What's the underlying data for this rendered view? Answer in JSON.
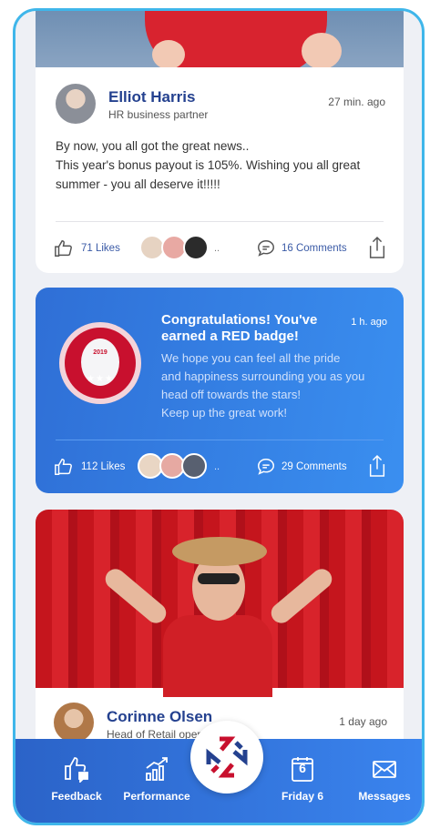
{
  "colors": {
    "accent": "#24418f",
    "frame": "#3fb6ea",
    "badge_red": "#c8102e",
    "nav_blue": "#2b63c8"
  },
  "post1": {
    "author": "Elliot Harris",
    "role": "HR business partner",
    "time": "27 min. ago",
    "lines": [
      "By now, you all got the great news..",
      "This year's bonus payout is 105%. Wishing you all great",
      "summer - you all deserve it!!!!!"
    ],
    "likes": "71 Likes",
    "more": "..",
    "comments": "16 Comments"
  },
  "badge_post": {
    "title": "Congratulations! You've earned a RED badge!",
    "time": "1 h. ago",
    "badge_year": "2019",
    "badge_stars": "★★★",
    "lines": [
      "We hope you can feel all the pride",
      "and happiness surrounding you as you",
      "head off towards the stars!",
      "Keep up the great work!"
    ],
    "likes": "112 Likes",
    "more": "..",
    "comments": "29 Comments"
  },
  "post3": {
    "author": "Corinne Olsen",
    "role": "Head of Retail operat",
    "time": "1 day ago"
  },
  "nav": {
    "feedback": "Feedback",
    "performance": "Performance",
    "friday_day": "6",
    "friday": "Friday 6",
    "messages": "Messages"
  },
  "icons": [
    "like-icon",
    "comment-icon",
    "share-icon",
    "feedback-icon",
    "performance-icon",
    "calendar-icon",
    "envelope-icon",
    "app-logo-icon"
  ]
}
